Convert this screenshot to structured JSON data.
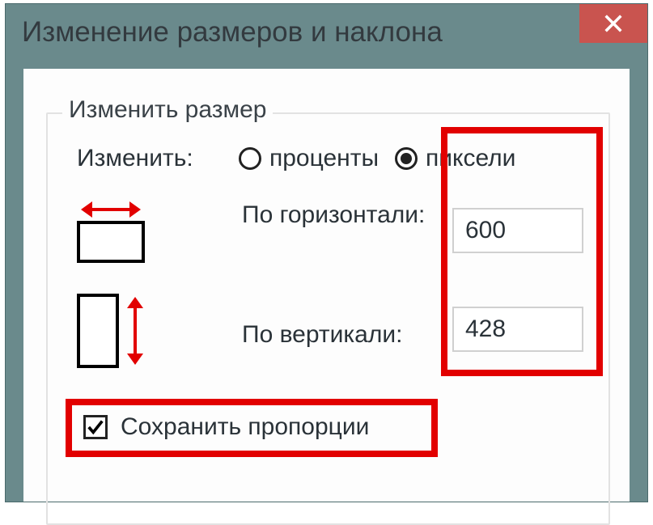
{
  "window": {
    "title": "Изменение размеров и наклона"
  },
  "group": {
    "legend": "Изменить размер",
    "unit_label": "Изменить:",
    "radio_percent": "проценты",
    "radio_pixels": "пиксели",
    "horizontal_label": "По горизонтали:",
    "vertical_label": "По вертикали:",
    "horizontal_value": "600",
    "vertical_value": "428",
    "keep_aspect": "Сохранить пропорции"
  }
}
